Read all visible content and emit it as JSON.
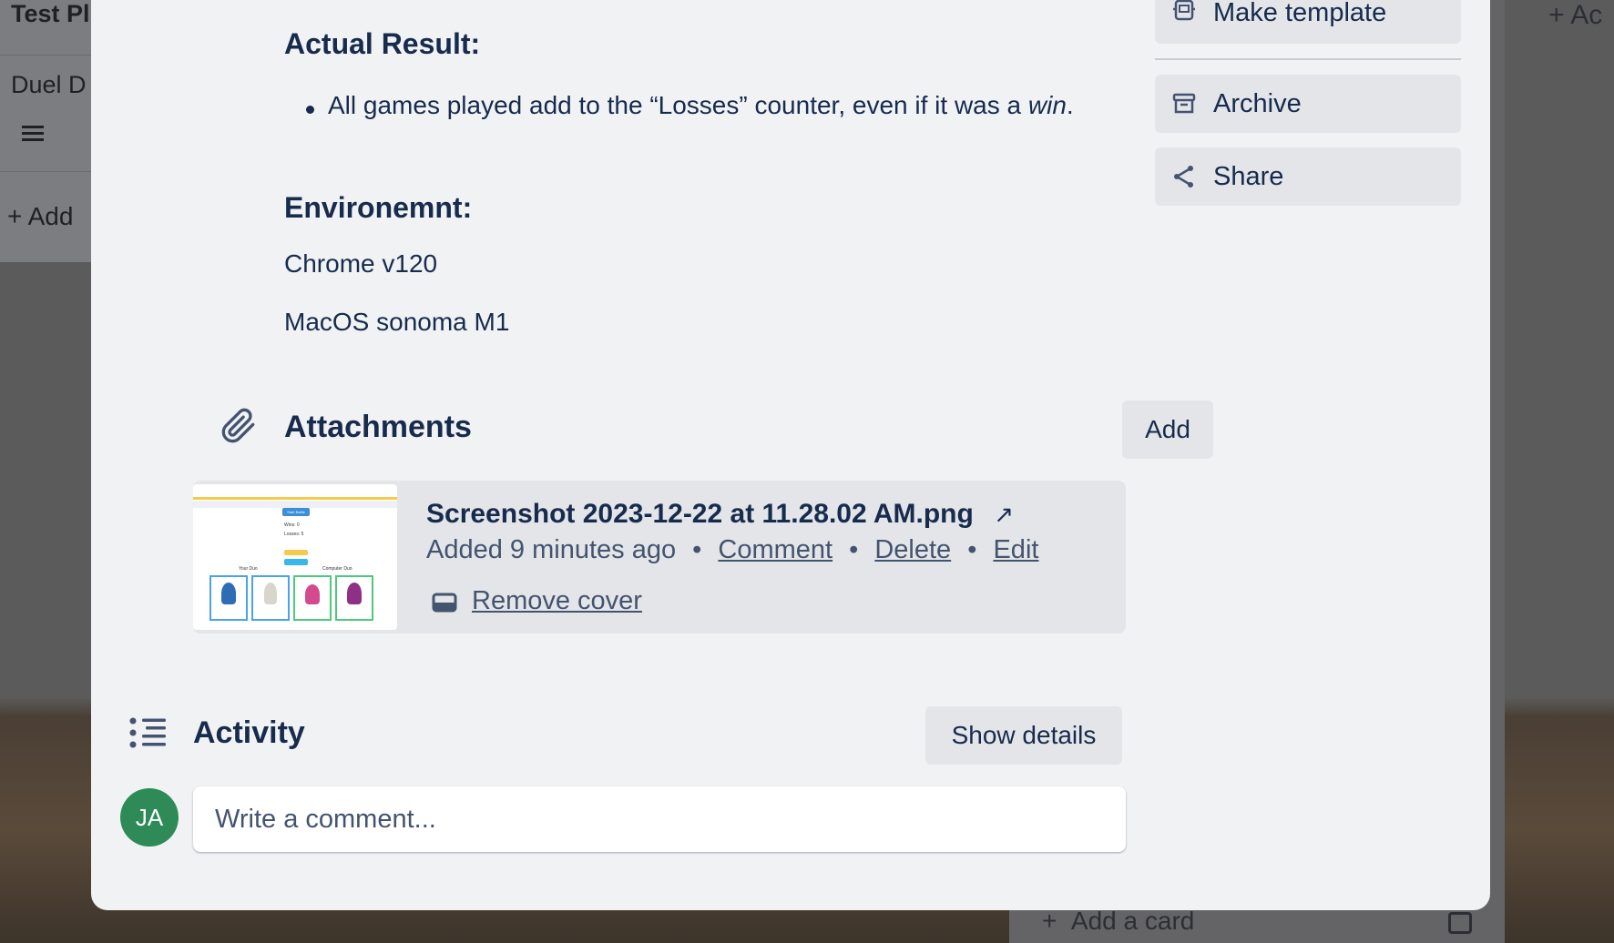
{
  "background": {
    "left_list_title": "Test Pl",
    "left_card_title": "Duel D",
    "left_add_label": "Add",
    "right_add_card_label": "Add a card",
    "top_right_add_label": "Ac"
  },
  "description": {
    "actual_result_heading": "Actual Result:",
    "actual_result_bullet_pre": "All games played add to the “Losses” counter, even if it was a ",
    "actual_result_bullet_em": "win",
    "actual_result_bullet_post": ".",
    "environment_heading": "Environemnt:",
    "environment_line1": "Chrome v120",
    "environment_line2": "MacOS sonoma M1"
  },
  "attachments": {
    "title": "Attachments",
    "add_button": "Add",
    "item": {
      "filename": "Screenshot 2023-12-22 at 11.28.02 AM.png",
      "added": "Added 9 minutes ago",
      "comment_link": "Comment",
      "delete_link": "Delete",
      "edit_link": "Edit",
      "remove_cover": "Remove cover"
    },
    "thumbnail": {
      "header_button": "Start Battle",
      "wins": "Wins: 0",
      "losses": "Losses: 5",
      "your_duo": "Your Duo",
      "computer_duo": "Computer Duo"
    }
  },
  "activity": {
    "title": "Activity",
    "show_details_button": "Show details",
    "avatar_initials": "JA",
    "comment_placeholder": "Write a comment..."
  },
  "sidebar": {
    "make_template": "Make template",
    "archive": "Archive",
    "share": "Share"
  },
  "colors": {
    "avatar_bg": "#2e8b57",
    "modal_bg": "#f1f2f4",
    "button_bg": "#e3e5e8",
    "text_primary": "#172b4d"
  }
}
